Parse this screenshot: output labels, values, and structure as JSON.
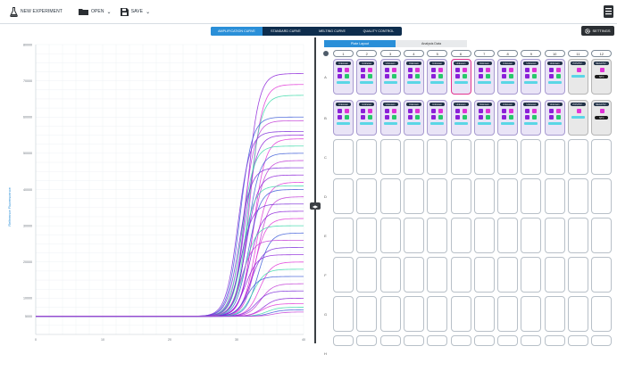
{
  "toolbar": {
    "new_experiment": "NEW EXPERIMENT",
    "open": "OPEN",
    "save": "SAVE",
    "icons": [
      "flask-icon",
      "folder-icon",
      "save-icon",
      "chevron-down-icon",
      "menu-icon"
    ]
  },
  "view_tabs": [
    {
      "label": "AMPLIFICATION CURVE",
      "active": true
    },
    {
      "label": "STANDARD CURVE",
      "active": false
    },
    {
      "label": "MELTING CURVE",
      "active": false
    },
    {
      "label": "QUALITY CONTROL",
      "active": false
    }
  ],
  "settings_label": "SETTINGS",
  "right_tabs": [
    {
      "label": "Plate Layout",
      "active": true
    },
    {
      "label": "Analysis Data",
      "active": false
    }
  ],
  "plate": {
    "columns": [
      "1",
      "2",
      "3",
      "4",
      "5",
      "6",
      "7",
      "8",
      "9",
      "10",
      "11",
      "12"
    ],
    "rows": [
      "A",
      "B",
      "C",
      "D",
      "E",
      "F",
      "G",
      "H"
    ],
    "unknown_label": "Unknown",
    "positive_label": "POSITIV...",
    "negative_label": "NEGATIV...",
    "ntc_label": "NTC",
    "colors": {
      "purple": "#8b20d8",
      "magenta": "#e033d6",
      "green": "#27c96a",
      "cyan": "#5ad6e6",
      "well_fill": "#e9e4f6"
    }
  },
  "chart_data": {
    "type": "line",
    "title": "",
    "xlabel": "",
    "ylabel": "Reference Fluorescence",
    "xlim": [
      0,
      40
    ],
    "ylim": [
      0,
      80000
    ],
    "x_ticks": [
      0,
      10,
      20,
      30,
      40
    ],
    "y_ticks": [
      5000,
      10000,
      20000,
      30000,
      40000,
      50000,
      60000,
      70000,
      80000
    ],
    "grid": true,
    "baseline": 5000,
    "series_colors": [
      "#8b20d8",
      "#e033d6",
      "#3bd9a8",
      "#3b5bd8",
      "#c13ad6",
      "#7a2ad8"
    ],
    "series": [
      {
        "plateau": 72000,
        "midpoint": 31.5
      },
      {
        "plateau": 69000,
        "midpoint": 32.0
      },
      {
        "plateau": 66000,
        "midpoint": 31.8
      },
      {
        "plateau": 60000,
        "midpoint": 30.5
      },
      {
        "plateau": 59000,
        "midpoint": 31.0
      },
      {
        "plateau": 56000,
        "midpoint": 30.2
      },
      {
        "plateau": 55000,
        "midpoint": 31.2
      },
      {
        "plateau": 54000,
        "midpoint": 32.5
      },
      {
        "plateau": 52000,
        "midpoint": 30.8
      },
      {
        "plateau": 50000,
        "midpoint": 31.6
      },
      {
        "plateau": 48000,
        "midpoint": 32.3
      },
      {
        "plateau": 46000,
        "midpoint": 30.4
      },
      {
        "plateau": 44000,
        "midpoint": 31.4
      },
      {
        "plateau": 42000,
        "midpoint": 32.8
      },
      {
        "plateau": 41000,
        "midpoint": 30.9
      },
      {
        "plateau": 40000,
        "midpoint": 31.7
      },
      {
        "plateau": 38000,
        "midpoint": 33.0
      },
      {
        "plateau": 36000,
        "midpoint": 30.6
      },
      {
        "plateau": 34000,
        "midpoint": 31.9
      },
      {
        "plateau": 32000,
        "midpoint": 32.6
      },
      {
        "plateau": 30000,
        "midpoint": 31.1
      },
      {
        "plateau": 28000,
        "midpoint": 33.2
      },
      {
        "plateau": 26000,
        "midpoint": 30.7
      },
      {
        "plateau": 24000,
        "midpoint": 32.1
      },
      {
        "plateau": 22000,
        "midpoint": 31.3
      },
      {
        "plateau": 20000,
        "midpoint": 33.4
      },
      {
        "plateau": 18000,
        "midpoint": 32.4
      },
      {
        "plateau": 16000,
        "midpoint": 31.5
      },
      {
        "plateau": 14000,
        "midpoint": 33.6
      },
      {
        "plateau": 12000,
        "midpoint": 32.9
      },
      {
        "plateau": 10000,
        "midpoint": 34.0
      },
      {
        "plateau": 8500,
        "midpoint": 33.8
      },
      {
        "plateau": 7500,
        "midpoint": 34.5
      },
      {
        "plateau": 6800,
        "midpoint": 35.0
      },
      {
        "plateau": 6200,
        "midpoint": 35.5
      }
    ]
  }
}
